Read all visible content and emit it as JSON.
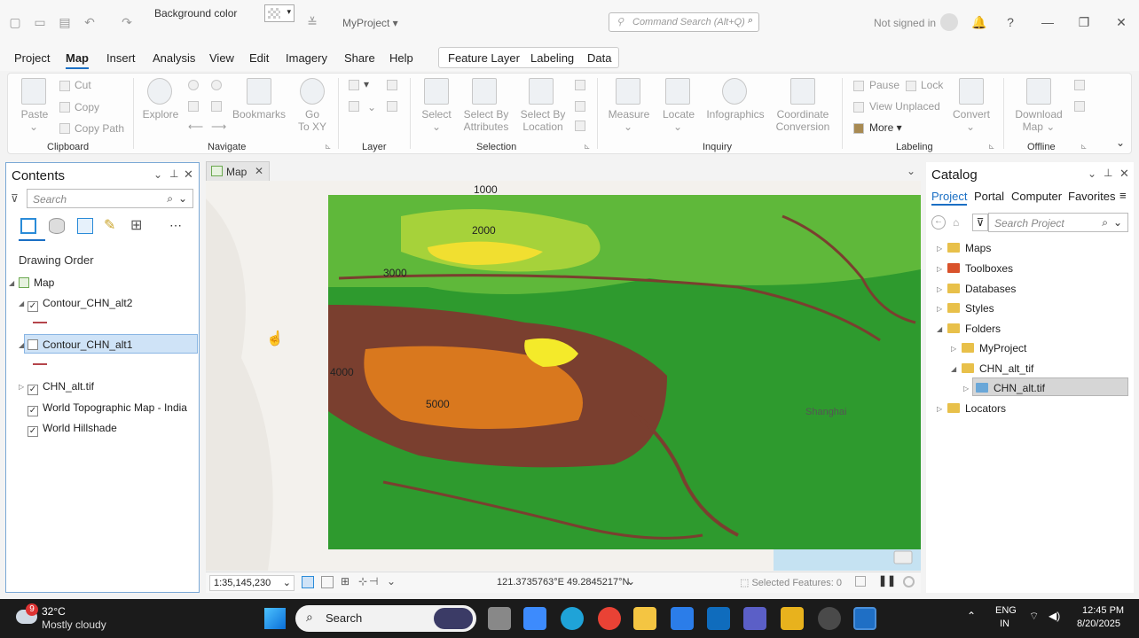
{
  "titlebar": {
    "bg_color_label": "Background color",
    "project_name": "MyProject",
    "command_search_placeholder": "Command Search (Alt+Q)",
    "signin_text": "Not signed in"
  },
  "menu": {
    "tabs": [
      "Project",
      "Map",
      "Insert",
      "Analysis",
      "View",
      "Edit",
      "Imagery",
      "Share",
      "Help"
    ],
    "active_tab": "Map",
    "context_tabs": [
      "Feature Layer",
      "Labeling",
      "Data"
    ]
  },
  "ribbon": {
    "paste": "Paste",
    "cut": "Cut",
    "copy": "Copy",
    "copy_path": "Copy Path",
    "explore": "Explore",
    "bookmarks": "Bookmarks",
    "go_to_xy_1": "Go",
    "go_to_xy_2": "To XY",
    "select": "Select",
    "select_by_attributes_1": "Select By",
    "select_by_attributes_2": "Attributes",
    "select_by_location_1": "Select By",
    "select_by_location_2": "Location",
    "measure": "Measure",
    "locate": "Locate",
    "infographics": "Infographics",
    "coordinate_conversion_1": "Coordinate",
    "coordinate_conversion_2": "Conversion",
    "pause": "Pause",
    "lock": "Lock",
    "view_unplaced": "View Unplaced",
    "more": "More",
    "convert": "Convert",
    "download_map_1": "Download",
    "download_map_2": "Map",
    "groups": {
      "clipboard": "Clipboard",
      "navigate": "Navigate",
      "layer": "Layer",
      "selection": "Selection",
      "inquiry": "Inquiry",
      "labeling": "Labeling",
      "offline": "Offline"
    }
  },
  "contents": {
    "title": "Contents",
    "search_placeholder": "Search",
    "drawing_order": "Drawing Order",
    "layers": [
      {
        "name": "Map",
        "checked": null
      },
      {
        "name": "Contour_CHN_alt2",
        "checked": true
      },
      {
        "name": "Contour_CHN_alt1",
        "checked": false
      },
      {
        "name": "CHN_alt.tif",
        "checked": true
      },
      {
        "name": "World Topographic Map - India",
        "checked": true
      },
      {
        "name": "World Hillshade",
        "checked": true
      }
    ]
  },
  "map": {
    "tab_label": "Map",
    "contour_labels": [
      "1000",
      "2000",
      "3000",
      "4000",
      "5000"
    ],
    "place_label": "Shanghai"
  },
  "status": {
    "scale": "1:35,145,230",
    "coordinates": "121.3735763°E 49.2845217°N",
    "selected_features": "Selected Features: 0"
  },
  "catalog": {
    "title": "Catalog",
    "tabs": [
      "Project",
      "Portal",
      "Computer",
      "Favorites"
    ],
    "search_placeholder": "Search Project",
    "items": [
      "Maps",
      "Toolboxes",
      "Databases",
      "Styles",
      "Folders",
      "MyProject",
      "CHN_alt_tif",
      "CHN_alt.tif",
      "Locators"
    ]
  },
  "taskbar": {
    "weather_badge": "9",
    "temperature": "32°C",
    "weather": "Mostly cloudy",
    "search_label": "Search",
    "lang_1": "ENG",
    "lang_2": "IN",
    "time": "12:45 PM",
    "date": "8/20/2025"
  }
}
